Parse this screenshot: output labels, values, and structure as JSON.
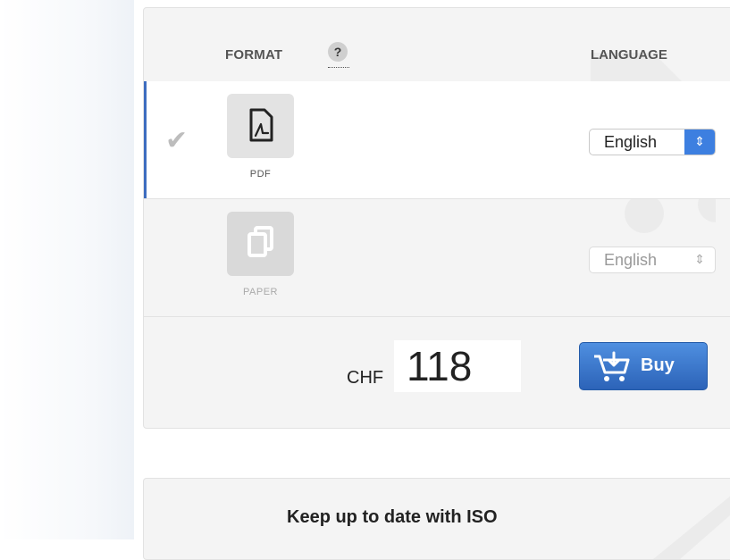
{
  "header": {
    "format_label": "FORMAT",
    "help_label": "?",
    "language_label": "LANGUAGE"
  },
  "formats": [
    {
      "label": "PDF",
      "icon": "pdf-file-icon",
      "selected": true,
      "language": "English"
    },
    {
      "label": "PAPER",
      "icon": "paper-copy-icon",
      "selected": false,
      "language": "English"
    }
  ],
  "purchase": {
    "currency": "CHF",
    "amount": "118",
    "buy_label": "Buy",
    "buy_icon": "cart-icon"
  },
  "newsletter": {
    "title": "Keep up to date with ISO"
  },
  "colors": {
    "accent": "#3d6dbf",
    "buy_button": "#2f6fc8"
  }
}
